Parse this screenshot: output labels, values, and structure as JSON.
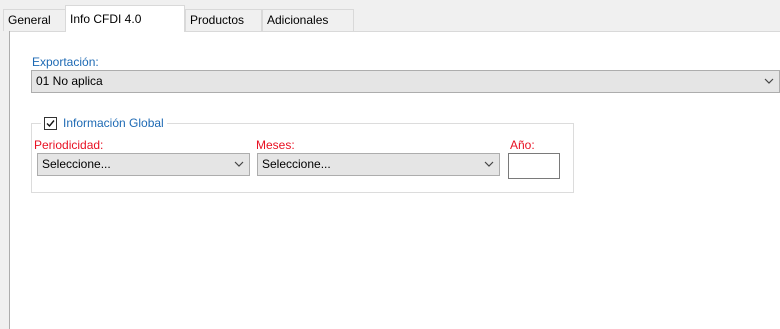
{
  "tabs": [
    {
      "label": "General",
      "active": false
    },
    {
      "label": "Info CFDI 4.0",
      "active": true
    },
    {
      "label": "Productos",
      "active": false
    },
    {
      "label": "Adicionales",
      "active": false
    }
  ],
  "exportacion": {
    "label": "Exportación:",
    "value": "01 No aplica"
  },
  "informacion_global": {
    "label": "Información Global",
    "checked": true,
    "periodicidad": {
      "label": "Periodicidad:",
      "value": "Seleccione..."
    },
    "meses": {
      "label": "Meses:",
      "value": "Seleccione..."
    },
    "anio": {
      "label": "Año:",
      "value": ""
    }
  },
  "colors": {
    "label_blue": "#1e6ab4",
    "label_red": "#e81123",
    "combo_bg": "#e5e5e5"
  },
  "icons": [
    "chevron-down-icon",
    "checkbox-checked-icon"
  ]
}
